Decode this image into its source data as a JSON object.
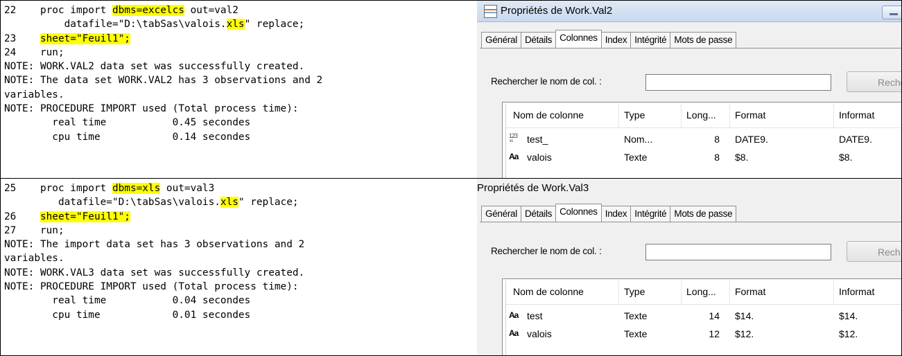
{
  "top_log": {
    "lines": [
      [
        {
          "t": "22    proc import "
        },
        {
          "t": "dbms=excelcs",
          "hl": true
        },
        {
          "t": " out=val2"
        }
      ],
      [
        {
          "t": "          datafile=\"D:\\tabSas\\valois."
        },
        {
          "t": "xls",
          "hl": true
        },
        {
          "t": "\" replace;"
        }
      ],
      [
        {
          "t": "23    "
        },
        {
          "t": "sheet=\"Feuil1\";",
          "hl": true
        }
      ],
      [
        {
          "t": "24    run;"
        }
      ],
      [
        {
          "t": "NOTE: WORK.VAL2 data set was successfully created."
        }
      ],
      [
        {
          "t": "NOTE: The data set WORK.VAL2 has 3 observations and 2"
        }
      ],
      [
        {
          "t": "variables."
        }
      ],
      [
        {
          "t": "NOTE: PROCEDURE IMPORT used (Total process time):"
        }
      ],
      [
        {
          "t": "        real time           0.45 secondes"
        }
      ],
      [
        {
          "t": "        cpu time            0.14 secondes"
        }
      ]
    ]
  },
  "bottom_log": {
    "lines": [
      [
        {
          "t": "25    proc import "
        },
        {
          "t": "dbms=xls",
          "hl": true
        },
        {
          "t": " out=val3"
        }
      ],
      [
        {
          "t": "         datafile=\"D:\\tabSas\\valois."
        },
        {
          "t": "xls",
          "hl": true
        },
        {
          "t": "\" replace;"
        }
      ],
      [
        {
          "t": "26    "
        },
        {
          "t": "sheet=\"Feuil1\";",
          "hl": true
        }
      ],
      [
        {
          "t": "27    run;"
        }
      ],
      [
        {
          "t": "NOTE: The import data set has 3 observations and 2"
        }
      ],
      [
        {
          "t": "variables."
        }
      ],
      [
        {
          "t": "NOTE: WORK.VAL3 data set was successfully created."
        }
      ],
      [
        {
          "t": "NOTE: PROCEDURE IMPORT used (Total process time):"
        }
      ],
      [
        {
          "t": "        real time           0.04 secondes"
        }
      ],
      [
        {
          "t": "        cpu time            0.01 secondes"
        }
      ]
    ]
  },
  "highlight_color": "#ffff00",
  "window_val2": {
    "title": "Propriétés de Work.Val2",
    "tabs": [
      "Général",
      "Détails",
      "Colonnes",
      "Index",
      "Intégrité",
      "Mots de passe"
    ],
    "active_tab": "Colonnes",
    "search_label": "Rechercher le nom de col. :",
    "search_value": "",
    "search_button": "Reche",
    "columns": [
      "Nom de colonne",
      "Type",
      "Long...",
      "Format",
      "Informat"
    ],
    "rows": [
      {
        "icon": "numeric-icon",
        "icon_glyph": "123\n⁴⁵",
        "name": "test_",
        "type": "Nom...",
        "length": "8",
        "format": "DATE9.",
        "informat": "DATE9."
      },
      {
        "icon": "text-icon",
        "icon_glyph": "Aa",
        "name": "valois",
        "type": "Texte",
        "length": "8",
        "format": "$8.",
        "informat": "$8."
      }
    ]
  },
  "window_val3": {
    "title": "Propriétés de Work.Val3",
    "tabs": [
      "Général",
      "Détails",
      "Colonnes",
      "Index",
      "Intégrité",
      "Mots de passe"
    ],
    "active_tab": "Colonnes",
    "search_label": "Rechercher le nom de col. :",
    "search_value": "",
    "search_button": "Rech",
    "columns": [
      "Nom de colonne",
      "Type",
      "Long...",
      "Format",
      "Informat"
    ],
    "rows": [
      {
        "icon": "text-icon",
        "icon_glyph": "Aa",
        "name": "test",
        "type": "Texte",
        "length": "14",
        "format": "$14.",
        "informat": "$14."
      },
      {
        "icon": "text-icon",
        "icon_glyph": "Aa",
        "name": "valois",
        "type": "Texte",
        "length": "12",
        "format": "$12.",
        "informat": "$12."
      }
    ]
  }
}
